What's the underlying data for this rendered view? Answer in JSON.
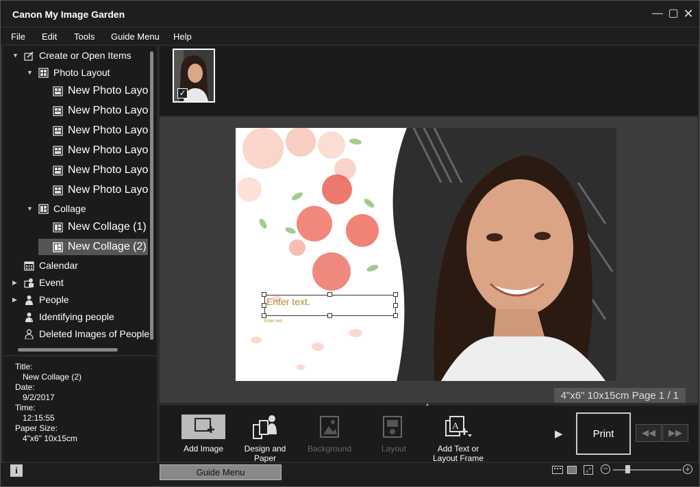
{
  "window": {
    "title": "Canon My Image Garden"
  },
  "menu": [
    "File",
    "Edit",
    "Tools",
    "Guide Menu",
    "Help"
  ],
  "tree": {
    "create_open": "Create or Open Items",
    "photo_layout": "Photo Layout",
    "photo_layout_items": [
      "New Photo Layo",
      "New Photo Layo",
      "New Photo Layo",
      "New Photo Layo",
      "New Photo Layo",
      "New Photo Layo"
    ],
    "collage": "Collage",
    "collage_items": [
      "New Collage (1)",
      "New Collage (2)"
    ],
    "calendar": "Calendar",
    "event": "Event",
    "people": "People",
    "identifying_people": "Identifying people",
    "deleted_images": "Deleted Images of People"
  },
  "info": {
    "title_label": "Title:",
    "title_value": "New Collage (2)",
    "date_label": "Date:",
    "date_value": "9/2/2017",
    "time_label": "Time:",
    "time_value": "12:15:55",
    "paper_label": "Paper Size:",
    "paper_value": "4\"x6\" 10x15cm"
  },
  "canvas": {
    "text_frame_placeholder": "Enter text.",
    "small_text": "Enter text.",
    "page_info": "4\"x6\" 10x15cm Page 1 / 1"
  },
  "toolbar": {
    "add_image": "Add Image",
    "design_paper": "Design and Paper",
    "background": "Background",
    "layout": "Layout",
    "add_text": "Add Text or Layout Frame",
    "print": "Print"
  },
  "status": {
    "guide_menu": "Guide Menu"
  },
  "colors": {
    "accent": "#ffffff",
    "panel": "#1b1b1b",
    "canvas": "#3c3c3c"
  }
}
